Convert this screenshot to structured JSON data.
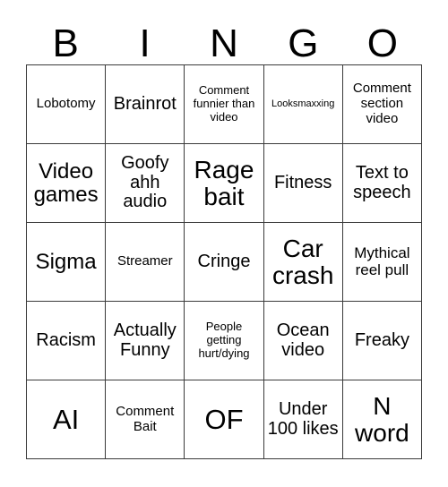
{
  "card": {
    "title_letters": [
      "B",
      "I",
      "N",
      "G",
      "O"
    ],
    "columns": 5,
    "rows": 5,
    "colors": {
      "background": "#ffffff",
      "text": "#000000",
      "grid_line": "#3a3a3a"
    },
    "cells": [
      [
        {
          "text": "Lobotomy",
          "size": "xs"
        },
        {
          "text": "Brainrot",
          "size": "md"
        },
        {
          "text": "Comment funnier than video",
          "size": "xxs"
        },
        {
          "text": "Looksmaxxing",
          "size": "tiny"
        },
        {
          "text": "Comment section video",
          "size": "xs"
        }
      ],
      [
        {
          "text": "Video games",
          "size": "lg"
        },
        {
          "text": "Goofy ahh audio",
          "size": "md"
        },
        {
          "text": "Rage bait",
          "size": "xl"
        },
        {
          "text": "Fitness",
          "size": "md"
        },
        {
          "text": "Text to speech",
          "size": "md"
        }
      ],
      [
        {
          "text": "Sigma",
          "size": "lg"
        },
        {
          "text": "Streamer",
          "size": "xs"
        },
        {
          "text": "Cringe",
          "size": "md"
        },
        {
          "text": "Car crash",
          "size": "xl"
        },
        {
          "text": "Mythical reel pull",
          "size": "sm"
        }
      ],
      [
        {
          "text": "Racism",
          "size": "md"
        },
        {
          "text": "Actually Funny",
          "size": "md"
        },
        {
          "text": "People getting hurt/dying",
          "size": "xxs"
        },
        {
          "text": "Ocean video",
          "size": "md"
        },
        {
          "text": "Freaky",
          "size": "md"
        }
      ],
      [
        {
          "text": "AI",
          "size": "xxl"
        },
        {
          "text": "Comment Bait",
          "size": "xs"
        },
        {
          "text": "OF",
          "size": "xxl"
        },
        {
          "text": "Under 100 likes",
          "size": "md"
        },
        {
          "text": "N word",
          "size": "xl"
        }
      ]
    ]
  }
}
